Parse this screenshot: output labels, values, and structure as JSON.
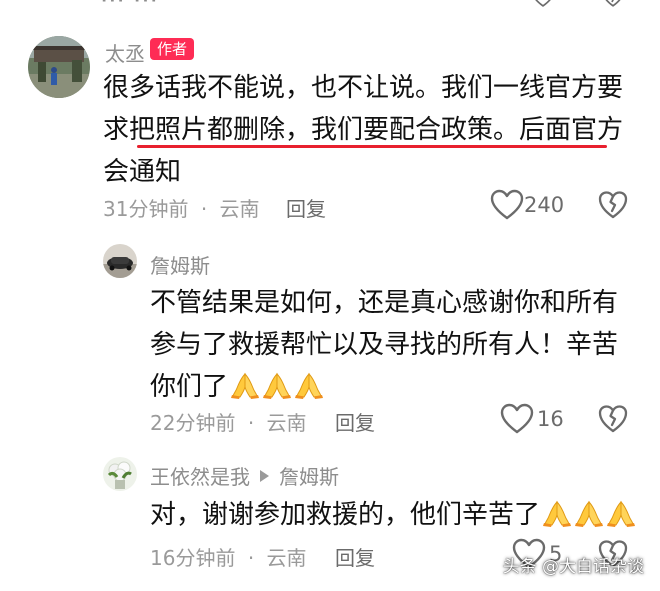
{
  "comments": [
    {
      "user": "太丞",
      "badge": "作者",
      "text": "很多话我不能说，也不让说。我们一线官方要求把照片都删除，我们要配合政策。后面官方会通知",
      "time": "31分钟前",
      "location": "云南",
      "reply_label": "回复",
      "likes": "240"
    },
    {
      "user": "詹姆斯",
      "text": "不管结果是如何，还是真心感谢你和所有参与了救援帮忙以及寻找的所有人！辛苦你们了",
      "emoji_count": 3,
      "time": "22分钟前",
      "location": "云南",
      "reply_label": "回复",
      "likes": "16"
    },
    {
      "user": "王依然是我",
      "reply_to": "詹姆斯",
      "text": "对，谢谢参加救援的，他们辛苦了",
      "emoji_count": 3,
      "time": "16分钟前",
      "location": "云南",
      "reply_label": "回复",
      "likes": "5"
    }
  ],
  "meta_separator": "·",
  "watermark": "头条 @大白话杂谈",
  "colors": {
    "accent_red": "#fe2c55",
    "underline_red": "#e8202e",
    "muted_text": "#9a9a9a"
  },
  "icons": {
    "like": "heart-outline-icon",
    "dislike": "broken-heart-icon",
    "emoji": "folded-hands-emoji"
  }
}
